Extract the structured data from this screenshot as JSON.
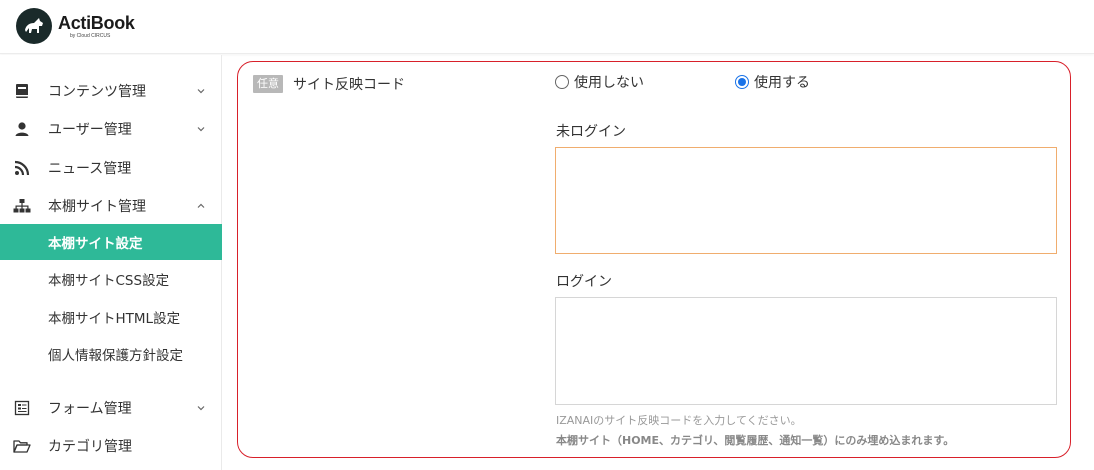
{
  "brand": {
    "name": "ActiBook",
    "sub": "by Cloud CIRCUS"
  },
  "sidebar": {
    "items": [
      {
        "label": "コンテンツ管理",
        "icon": "book-icon"
      },
      {
        "label": "ユーザー管理",
        "icon": "user-icon"
      },
      {
        "label": "ニュース管理",
        "icon": "rss-icon"
      },
      {
        "label": "本棚サイト管理",
        "icon": "sitemap-icon"
      }
    ],
    "subitems": [
      {
        "label": "本棚サイト設定",
        "active": true
      },
      {
        "label": "本棚サイトCSS設定"
      },
      {
        "label": "本棚サイトHTML設定"
      },
      {
        "label": "個人情報保護方針設定"
      }
    ],
    "lower_items": [
      {
        "label": "フォーム管理",
        "icon": "form-icon"
      },
      {
        "label": "カテゴリ管理",
        "icon": "folder-icon"
      }
    ]
  },
  "field": {
    "badge": "任意",
    "label": "サイト反映コード",
    "options": [
      {
        "label": "使用しない",
        "checked": false
      },
      {
        "label": "使用する",
        "checked": true
      }
    ],
    "not_logged_in_label": "未ログイン",
    "not_logged_in_value": "",
    "logged_in_label": "ログイン",
    "logged_in_value": "",
    "help_text": "IZANAIのサイト反映コードを入力してください。",
    "help_note": "本棚サイト（HOME、カテゴリ、閲覧履歴、通知一覧）にのみ埋め込まれます。"
  },
  "colors": {
    "accent": "#2eb998",
    "highlight": "#d8202a",
    "radio": "#1a73e8",
    "focus": "#f0ad6e"
  }
}
